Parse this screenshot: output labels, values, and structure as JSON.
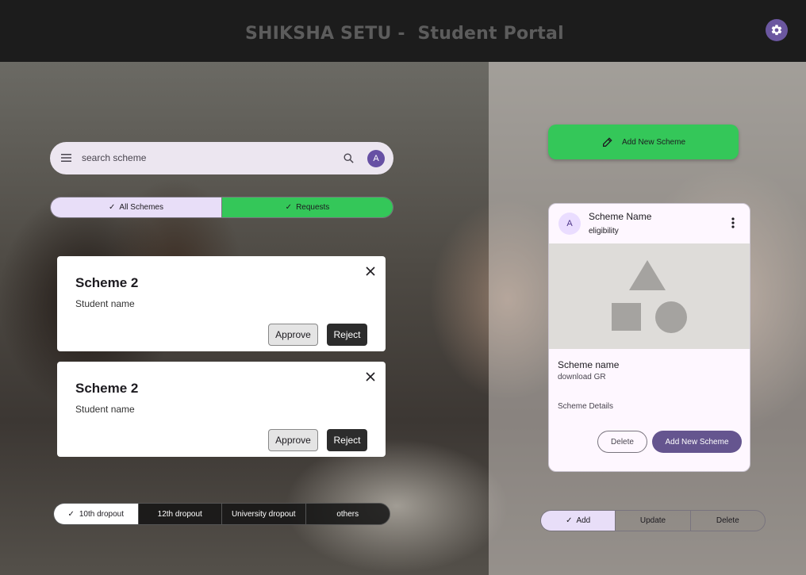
{
  "header": {
    "title": "SHIKSHA SETU -  Student Portal",
    "settings_icon": "gear-icon"
  },
  "search": {
    "placeholder": "search scheme",
    "avatar_initial": "A"
  },
  "tabs": [
    {
      "label": "All Schemes",
      "selected": true
    },
    {
      "label": "Requests",
      "selected": true
    }
  ],
  "requests": [
    {
      "title": "Scheme 2",
      "student": "Student name",
      "approve_label": "Approve",
      "reject_label": "Reject"
    },
    {
      "title": "Scheme 2",
      "student": "Student name",
      "approve_label": "Approve",
      "reject_label": "Reject"
    }
  ],
  "filters": [
    {
      "label": "10th dropout",
      "selected": true
    },
    {
      "label": "12th dropout",
      "selected": false
    },
    {
      "label": "University dropout",
      "selected": false
    },
    {
      "label": "others",
      "selected": false
    }
  ],
  "add_scheme_fab": {
    "label": "Add New Scheme",
    "icon": "pencil-icon"
  },
  "scheme_card": {
    "avatar_initial": "A",
    "title": "Scheme Name",
    "subtitle": "eligibility",
    "name": "Scheme name",
    "link": "download GR",
    "details": "Scheme Details",
    "delete_label": "Delete",
    "add_label": "Add New Scheme"
  },
  "actions": [
    {
      "label": "Add",
      "selected": true
    },
    {
      "label": "Update",
      "selected": false
    },
    {
      "label": "Delete",
      "selected": false
    }
  ],
  "colors": {
    "accent_green": "#34c759",
    "accent_purple": "#65558f",
    "header_bg": "#1c1c1c"
  }
}
